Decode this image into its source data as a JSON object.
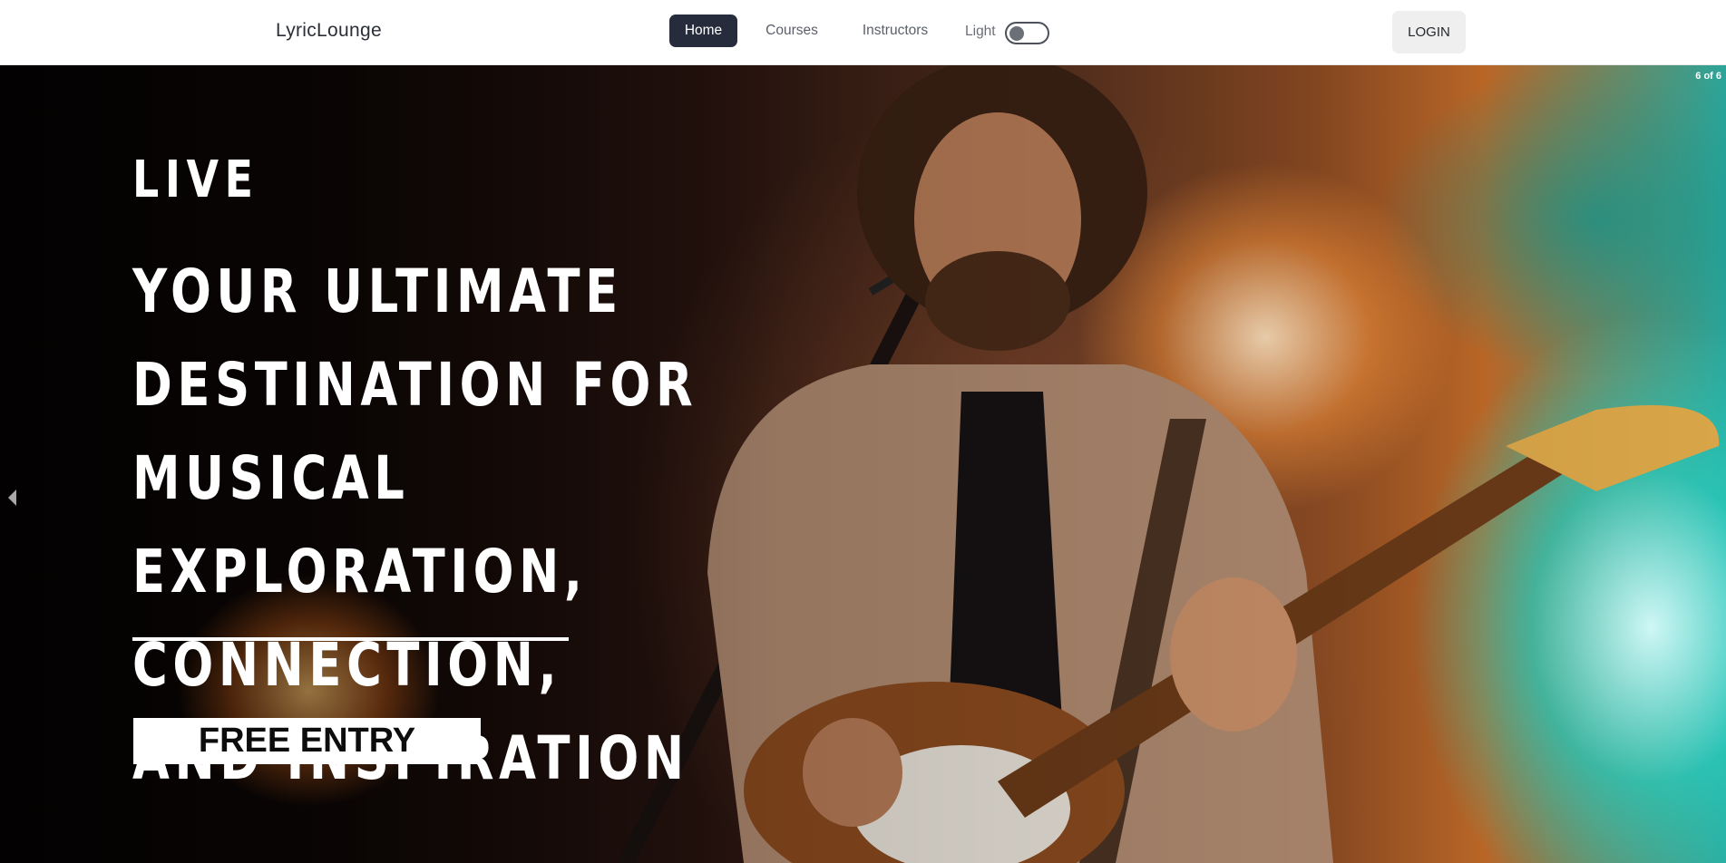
{
  "navbar": {
    "brand": "LyricLounge",
    "links": [
      {
        "label": "Home",
        "active": true
      },
      {
        "label": "Courses",
        "active": false
      },
      {
        "label": "Instructors",
        "active": false
      }
    ],
    "theme_toggle": {
      "label": "Light",
      "on": false
    },
    "login_label": "LOGIN"
  },
  "hero": {
    "slide_counter": "6 of 6",
    "label": "LIVE",
    "title_lines": [
      "YOUR ULTIMATE",
      "DESTINATION FOR MUSICAL",
      "EXPLORATION, CONNECTION,",
      "AND INSPIRATION"
    ],
    "cta_label": "FREE ENTRY",
    "image_description_icons": {
      "prev": "chevron-left-icon"
    }
  },
  "colors": {
    "nav_active_bg": "#262c3b",
    "login_bg": "#efefef",
    "hero_text": "#ffffff",
    "cta_bg": "#ffffff",
    "cta_text": "#0d0d0d"
  }
}
